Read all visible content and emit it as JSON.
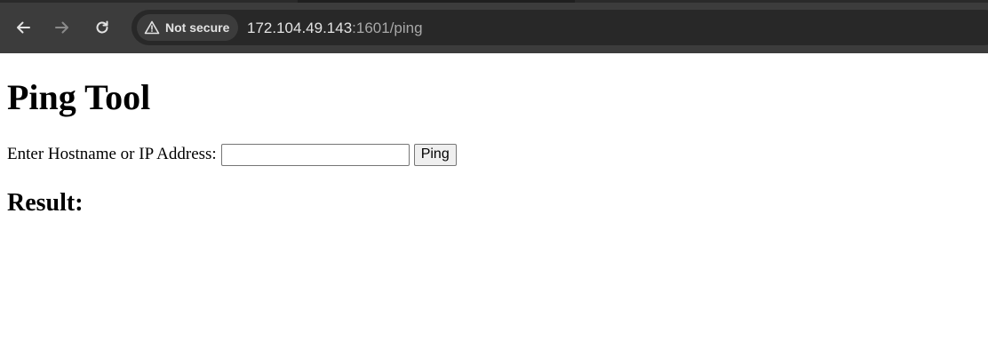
{
  "browser": {
    "security_label": "Not secure",
    "url_host": "172.104.49.143",
    "url_port_path": ":1601/ping",
    "icons": {
      "back": "arrow-left",
      "forward": "arrow-right",
      "reload": "reload",
      "warning": "warning-triangle"
    }
  },
  "page": {
    "title": "Ping Tool",
    "form": {
      "label": "Enter Hostname or IP Address:",
      "input_value": "",
      "button_label": "Ping"
    },
    "result_heading": "Result:"
  }
}
